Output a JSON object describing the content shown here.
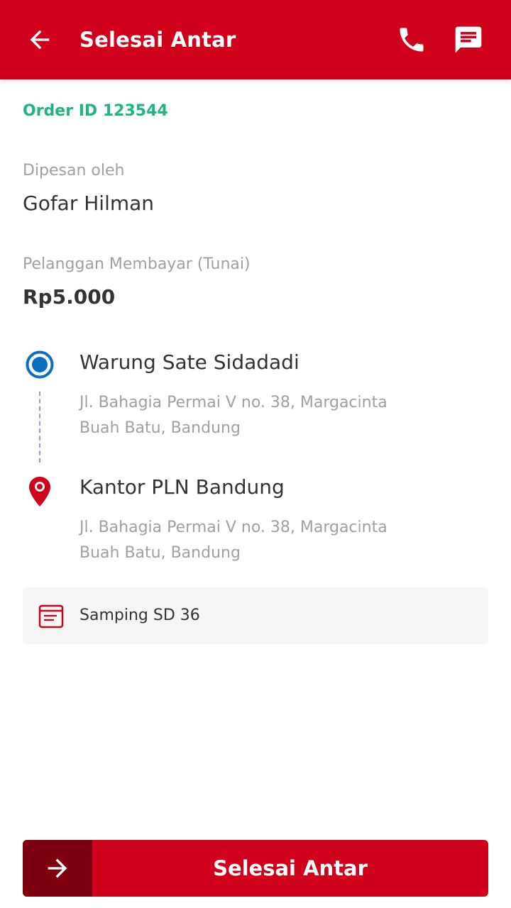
{
  "colors": {
    "primary": "#D0021B",
    "primary_dark": "#7E0010",
    "accent_green": "#1DB584",
    "origin_blue": "#0A6FC2",
    "text_dark": "#333333",
    "text_muted": "#A0A0A0",
    "note_bg": "#F6F6F6"
  },
  "appbar": {
    "title": "Selesai Antar",
    "back_icon": "arrow-left-icon",
    "call_icon": "phone-icon",
    "chat_icon": "chat-message-icon"
  },
  "order": {
    "id_text": "Order ID 123544"
  },
  "customer": {
    "label": "Dipesan oleh",
    "name": "Gofar Hilman"
  },
  "payment": {
    "label": "Pelanggan Membayar (Tunai)",
    "amount": "Rp5.000"
  },
  "route": {
    "origin": {
      "name": "Warung Sate Sidadadi",
      "address_line1": "Jl. Bahagia Permai V no. 38, Margacinta",
      "address_line2": "Buah Batu, Bandung",
      "icon": "origin-radio-icon"
    },
    "destination": {
      "name": "Kantor PLN Bandung",
      "address_line1": "Jl. Bahagia Permai V no. 38, Margacinta",
      "address_line2": "Buah Batu, Bandung",
      "icon": "location-pin-icon"
    }
  },
  "note": {
    "icon": "note-icon",
    "text": "Samping SD 36"
  },
  "cta": {
    "icon": "arrow-right-icon",
    "label": "Selesai Antar"
  }
}
